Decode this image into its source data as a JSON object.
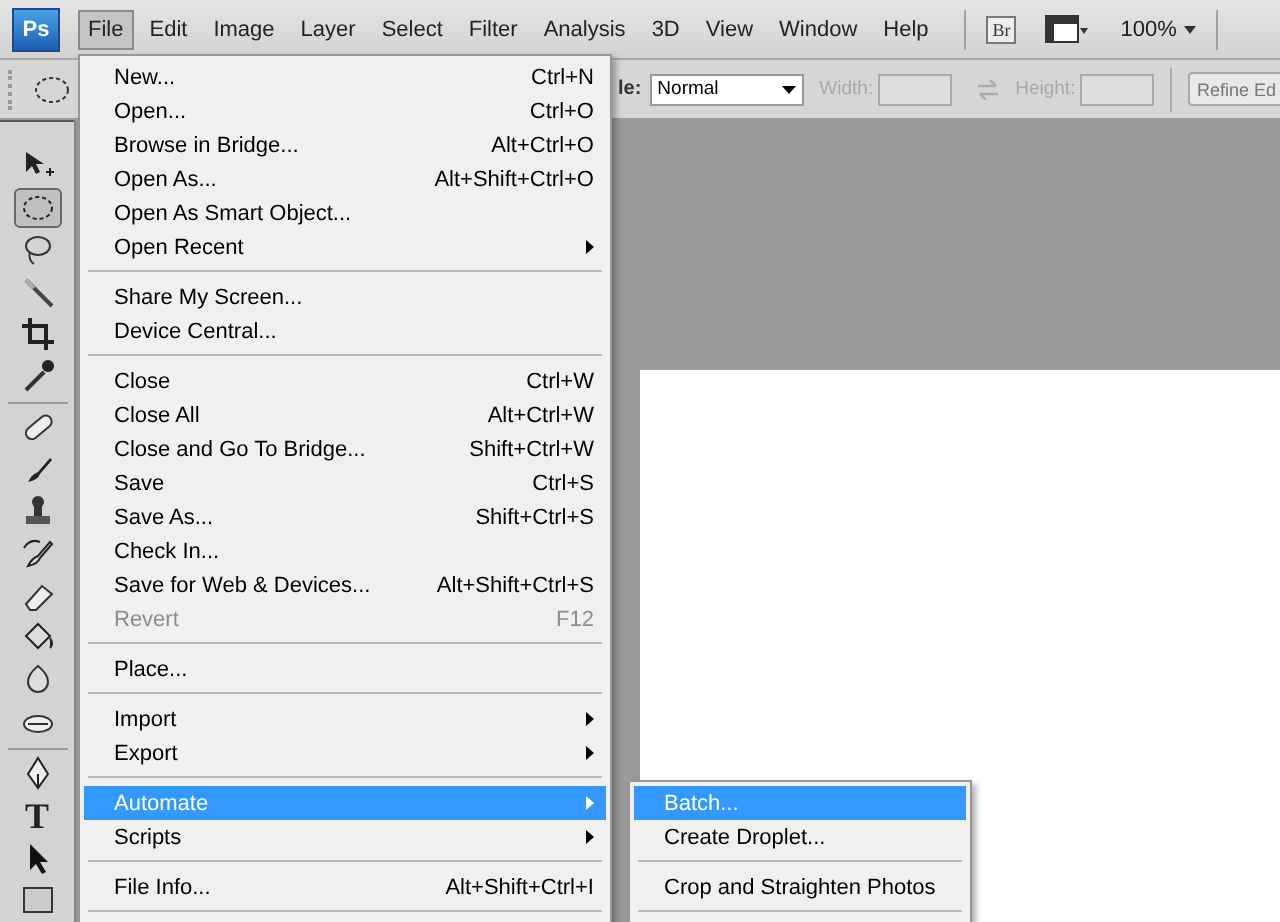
{
  "app": {
    "logo": "Ps"
  },
  "menu_bar": [
    {
      "label": "File",
      "selected": true
    },
    {
      "label": "Edit",
      "selected": false
    },
    {
      "label": "Image",
      "selected": false
    },
    {
      "label": "Layer",
      "selected": false
    },
    {
      "label": "Select",
      "selected": false
    },
    {
      "label": "Filter",
      "selected": false
    },
    {
      "label": "Analysis",
      "selected": false
    },
    {
      "label": "3D",
      "selected": false
    },
    {
      "label": "View",
      "selected": false
    },
    {
      "label": "Window",
      "selected": false
    },
    {
      "label": "Help",
      "selected": false
    }
  ],
  "app_bar": {
    "bridge": "Br",
    "zoom": "100%"
  },
  "options_bar": {
    "style_label": "le:",
    "style_value": "Normal",
    "width_label": "Width:",
    "height_label": "Height:",
    "refine_button": "Refine Ed"
  },
  "tools": [
    {
      "kind": "move",
      "selected": false
    },
    {
      "kind": "marquee",
      "selected": true
    },
    {
      "kind": "lasso",
      "selected": false
    },
    {
      "kind": "wand",
      "selected": false
    },
    {
      "kind": "crop",
      "selected": false
    },
    {
      "kind": "eyedropper",
      "selected": false
    },
    {
      "kind": "separator"
    },
    {
      "kind": "healing",
      "selected": false
    },
    {
      "kind": "brush",
      "selected": false
    },
    {
      "kind": "stamp",
      "selected": false
    },
    {
      "kind": "history",
      "selected": false
    },
    {
      "kind": "eraser",
      "selected": false
    },
    {
      "kind": "bucket",
      "selected": false
    },
    {
      "kind": "blur",
      "selected": false
    },
    {
      "kind": "dodge",
      "selected": false
    },
    {
      "kind": "separator"
    },
    {
      "kind": "pen",
      "selected": false
    },
    {
      "kind": "type",
      "label": "T",
      "selected": false
    },
    {
      "kind": "path",
      "selected": false
    },
    {
      "kind": "shape",
      "selected": false
    }
  ],
  "file_menu": [
    {
      "kind": "item",
      "label": "New...",
      "shortcut": "Ctrl+N",
      "submenu": false,
      "disabled": false,
      "selected": false
    },
    {
      "kind": "item",
      "label": "Open...",
      "shortcut": "Ctrl+O",
      "submenu": false,
      "disabled": false,
      "selected": false
    },
    {
      "kind": "item",
      "label": "Browse in Bridge...",
      "shortcut": "Alt+Ctrl+O",
      "submenu": false,
      "disabled": false,
      "selected": false
    },
    {
      "kind": "item",
      "label": "Open As...",
      "shortcut": "Alt+Shift+Ctrl+O",
      "submenu": false,
      "disabled": false,
      "selected": false
    },
    {
      "kind": "item",
      "label": "Open As Smart Object...",
      "submenu": false,
      "disabled": false,
      "selected": false
    },
    {
      "kind": "item",
      "label": "Open Recent",
      "submenu": true,
      "disabled": false,
      "selected": false
    },
    {
      "kind": "separator"
    },
    {
      "kind": "item",
      "label": "Share My Screen...",
      "submenu": false,
      "disabled": false,
      "selected": false
    },
    {
      "kind": "item",
      "label": "Device Central...",
      "submenu": false,
      "disabled": false,
      "selected": false
    },
    {
      "kind": "separator"
    },
    {
      "kind": "item",
      "label": "Close",
      "shortcut": "Ctrl+W",
      "submenu": false,
      "disabled": false,
      "selected": false
    },
    {
      "kind": "item",
      "label": "Close All",
      "shortcut": "Alt+Ctrl+W",
      "submenu": false,
      "disabled": false,
      "selected": false
    },
    {
      "kind": "item",
      "label": "Close and Go To Bridge...",
      "shortcut": "Shift+Ctrl+W",
      "submenu": false,
      "disabled": false,
      "selected": false
    },
    {
      "kind": "item",
      "label": "Save",
      "shortcut": "Ctrl+S",
      "submenu": false,
      "disabled": false,
      "selected": false
    },
    {
      "kind": "item",
      "label": "Save As...",
      "shortcut": "Shift+Ctrl+S",
      "submenu": false,
      "disabled": false,
      "selected": false
    },
    {
      "kind": "item",
      "label": "Check In...",
      "submenu": false,
      "disabled": false,
      "selected": false
    },
    {
      "kind": "item",
      "label": "Save for Web & Devices...",
      "shortcut": "Alt+Shift+Ctrl+S",
      "submenu": false,
      "disabled": false,
      "selected": false
    },
    {
      "kind": "item",
      "label": "Revert",
      "shortcut": "F12",
      "submenu": false,
      "disabled": true,
      "selected": false
    },
    {
      "kind": "separator"
    },
    {
      "kind": "item",
      "label": "Place...",
      "submenu": false,
      "disabled": false,
      "selected": false
    },
    {
      "kind": "separator"
    },
    {
      "kind": "item",
      "label": "Import",
      "submenu": true,
      "disabled": false,
      "selected": false
    },
    {
      "kind": "item",
      "label": "Export",
      "submenu": true,
      "disabled": false,
      "selected": false
    },
    {
      "kind": "separator"
    },
    {
      "kind": "item",
      "label": "Automate",
      "submenu": true,
      "disabled": false,
      "selected": true
    },
    {
      "kind": "item",
      "label": "Scripts",
      "submenu": true,
      "disabled": false,
      "selected": false
    },
    {
      "kind": "separator"
    },
    {
      "kind": "item",
      "label": "File Info...",
      "shortcut": "Alt+Shift+Ctrl+I",
      "submenu": false,
      "disabled": false,
      "selected": false
    },
    {
      "kind": "separator"
    }
  ],
  "automate_menu": [
    {
      "kind": "item",
      "label": "Batch...",
      "selected": true
    },
    {
      "kind": "item",
      "label": "Create Droplet...",
      "selected": false
    },
    {
      "kind": "separator"
    },
    {
      "kind": "item",
      "label": "Crop and Straighten Photos",
      "selected": false
    },
    {
      "kind": "separator"
    }
  ]
}
